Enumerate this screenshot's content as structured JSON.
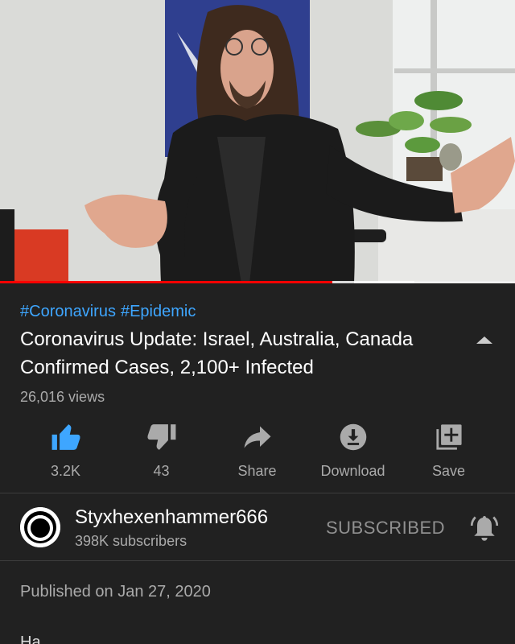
{
  "video": {
    "progress_played": 0.645,
    "progress_buffered": 0.805
  },
  "hashtags": [
    "#Coronavirus",
    "#Epidemic"
  ],
  "title": "Coronavirus Update: Israel, Australia, Canada Confirmed Cases, 2,100+ Infected",
  "views": "26,016 views",
  "actions": [
    {
      "label": "3.2K",
      "icon": "thumbs-up-icon"
    },
    {
      "label": "43",
      "icon": "thumbs-down-icon"
    },
    {
      "label": "Share",
      "icon": "share-icon"
    },
    {
      "label": "Download",
      "icon": "download-icon"
    },
    {
      "label": "Save",
      "icon": "add-to-playlist-icon"
    }
  ],
  "channel": {
    "name": "Styxhexenhammer666",
    "subscribers": "398K subscribers",
    "subscribe_label": "SUBSCRIBED"
  },
  "published": "Published on Jan 27, 2020",
  "description_preview": "Ha...",
  "colors": {
    "background": "#212121",
    "accent_blue": "#3ea6ff",
    "progress_red": "#ff0000",
    "like_active": "#3ea6ff"
  }
}
